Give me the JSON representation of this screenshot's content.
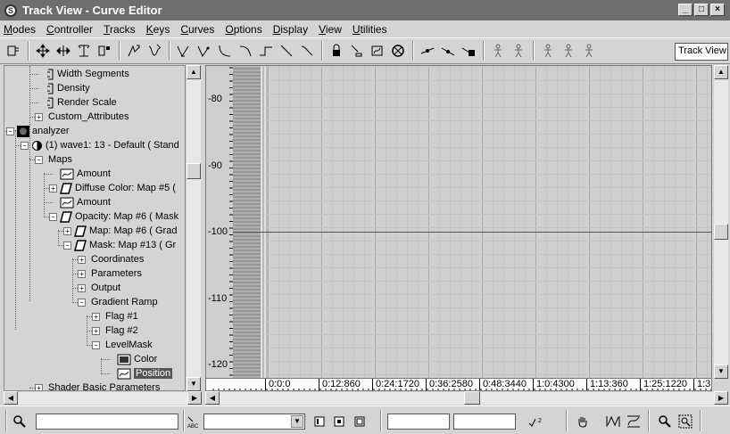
{
  "window": {
    "title": "Track View - Curve Editor"
  },
  "menu": [
    {
      "u": "M",
      "rest": "odes"
    },
    {
      "u": "C",
      "rest": "ontroller"
    },
    {
      "u": "T",
      "rest": "racks"
    },
    {
      "u": "K",
      "rest": "eys"
    },
    {
      "u": "C",
      "rest": "urves"
    },
    {
      "u": "O",
      "rest": "ptions"
    },
    {
      "u": "D",
      "rest": "isplay"
    },
    {
      "u": "V",
      "rest": "iew"
    },
    {
      "u": "U",
      "rest": "tilities"
    }
  ],
  "toolbar": {
    "view_name": "Track View"
  },
  "tree": [
    {
      "label": "Width Segments",
      "depth": 3,
      "icon": "param-icon",
      "pm": ""
    },
    {
      "label": "Density",
      "depth": 3,
      "icon": "param-icon",
      "pm": ""
    },
    {
      "label": "Render Scale",
      "depth": 3,
      "icon": "param-icon",
      "pm": ""
    },
    {
      "label": "Custom_Attributes",
      "depth": 3,
      "icon": "",
      "pm": "+"
    },
    {
      "label": "analyzer",
      "depth": 1,
      "icon": "object-icon",
      "pm": "-"
    },
    {
      "label": "(1) wave1: 13 - Default  ( Stand",
      "depth": 2,
      "icon": "material-icon",
      "pm": "-"
    },
    {
      "label": "Maps",
      "depth": 3,
      "icon": "",
      "pm": "-"
    },
    {
      "label": "Amount",
      "depth": 4,
      "icon": "curve-param-icon",
      "pm": ""
    },
    {
      "label": "Diffuse Color: Map #5  (",
      "depth": 4,
      "icon": "map-icon",
      "pm": "+"
    },
    {
      "label": "Amount",
      "depth": 4,
      "icon": "curve-param-icon",
      "pm": ""
    },
    {
      "label": "Opacity: Map #6  ( Mask",
      "depth": 4,
      "icon": "map-icon",
      "pm": "-"
    },
    {
      "label": "Map: Map #6  ( Grad",
      "depth": 5,
      "icon": "map-icon",
      "pm": "+"
    },
    {
      "label": "Mask: Map #13  ( Gr",
      "depth": 5,
      "icon": "map-icon",
      "pm": "-"
    },
    {
      "label": "Coordinates",
      "depth": 6,
      "icon": "",
      "pm": "+"
    },
    {
      "label": "Parameters",
      "depth": 6,
      "icon": "",
      "pm": "+"
    },
    {
      "label": "Output",
      "depth": 6,
      "icon": "",
      "pm": "+"
    },
    {
      "label": "Gradient Ramp",
      "depth": 6,
      "icon": "",
      "pm": "-"
    },
    {
      "label": "Flag #1",
      "depth": 7,
      "icon": "",
      "pm": "+"
    },
    {
      "label": "Flag #2",
      "depth": 7,
      "icon": "",
      "pm": "+"
    },
    {
      "label": "LevelMask",
      "depth": 7,
      "icon": "",
      "pm": "-"
    },
    {
      "label": "Color",
      "depth": 8,
      "icon": "color-icon",
      "pm": ""
    },
    {
      "label": "Position",
      "depth": 8,
      "icon": "curve-param-icon",
      "pm": "",
      "selected": true
    },
    {
      "label": "Shader Basic Parameters",
      "depth": 3,
      "icon": "",
      "pm": "+"
    }
  ],
  "curve": {
    "y_labels": [
      "-80",
      "-90",
      "-100",
      "-110",
      "-120"
    ],
    "time_labels": [
      "0:0:0",
      "0:12:860",
      "0:24:1720",
      "0:36:2580",
      "0:48:3440",
      "1:0:4300",
      "1:13:360",
      "1:25:1220",
      "1:3"
    ]
  }
}
